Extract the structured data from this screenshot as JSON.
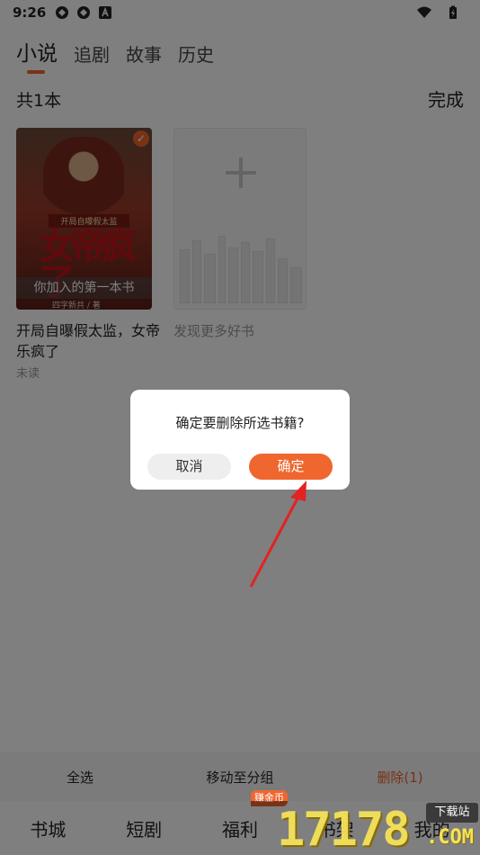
{
  "status_bar": {
    "time": "9:26"
  },
  "tabs": [
    {
      "label": "小说",
      "active": true
    },
    {
      "label": "追剧",
      "active": false
    },
    {
      "label": "故事",
      "active": false
    },
    {
      "label": "历史",
      "active": false
    }
  ],
  "shelf": {
    "count_text": "共1本",
    "done_label": "完成",
    "book": {
      "cover_subtitle": "开局自曝假太监",
      "cover_title": "女帝疯了",
      "cover_banner": "你加入的第一本书",
      "cover_author": "四字新共 / 著",
      "title": "开局自曝假太监，女帝乐疯了",
      "status": "未读",
      "selected": true
    },
    "discover_label": "发现更多好书"
  },
  "dialog": {
    "message": "确定要删除所选书籍?",
    "cancel_label": "取消",
    "confirm_label": "确定"
  },
  "action_bar": {
    "select_all": "全选",
    "move_to_group": "移动至分组",
    "delete": "删除(1)"
  },
  "bottom_nav": {
    "items": [
      "书城",
      "短剧",
      "福利",
      "书架",
      "我的"
    ],
    "badge": "赚金币"
  },
  "watermark": {
    "digits": "17178",
    "site": "下载站",
    "domain": ".COM"
  },
  "colors": {
    "accent": "#f0662f",
    "overlay": "rgba(0,0,0,0.5)"
  }
}
